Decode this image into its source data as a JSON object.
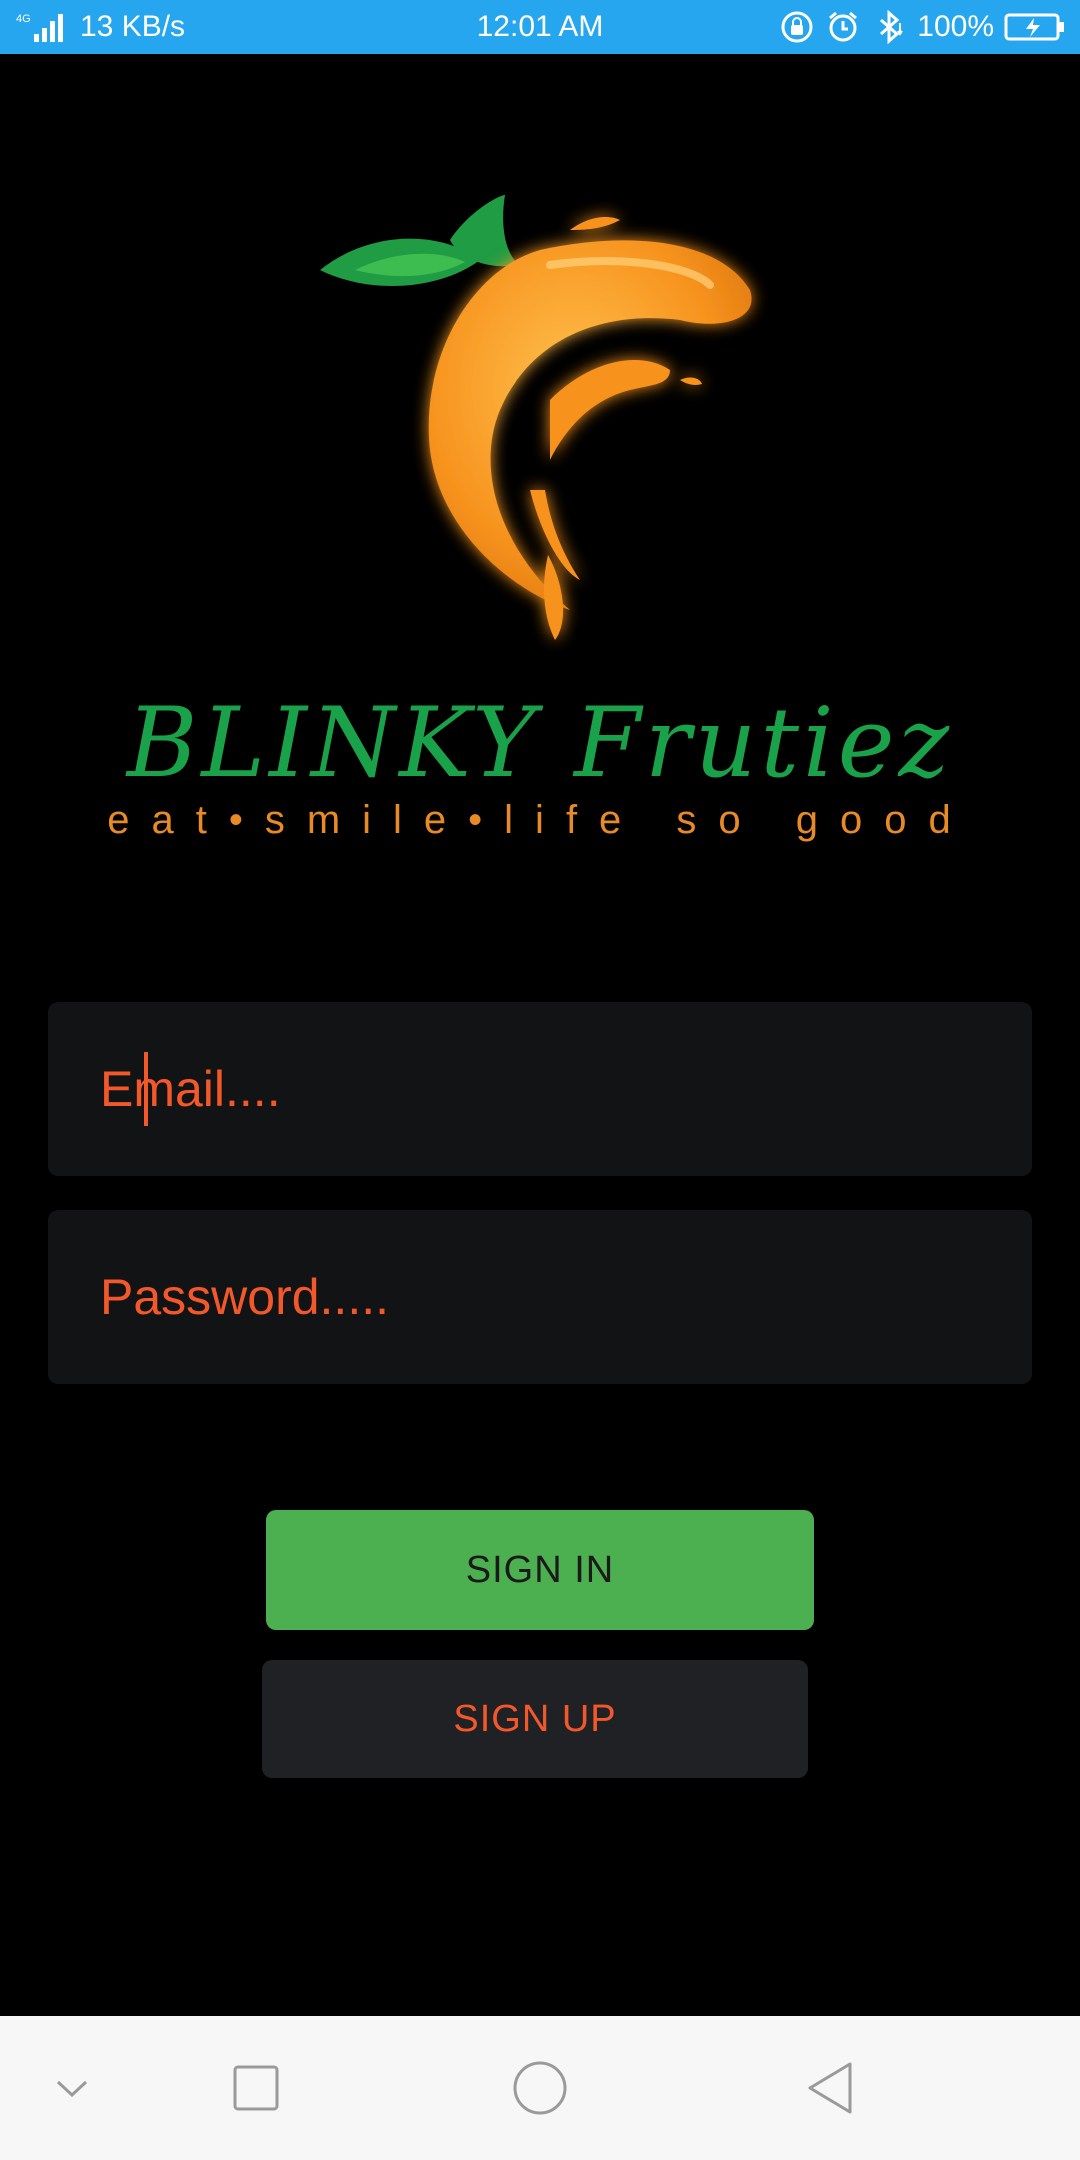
{
  "status_bar": {
    "network": "4G",
    "speed": "13 KB/s",
    "time": "12:01 AM",
    "battery": "100%",
    "icons": [
      "signal-icon",
      "rotation-lock-icon",
      "alarm-icon",
      "bluetooth-icon",
      "battery-charging-icon"
    ]
  },
  "logo": {
    "brand": "BLINKY Frutiez",
    "tagline": "eat•smile•life so good"
  },
  "form": {
    "email_placeholder": "Email....",
    "password_placeholder": "Password....."
  },
  "buttons": {
    "sign_in": "SIGN IN",
    "sign_up": "SIGN UP"
  },
  "nav_bar": {
    "icons": [
      "chevron-down-icon",
      "recents-icon",
      "home-icon",
      "back-icon"
    ]
  },
  "colors": {
    "status_bar": "#26a6ef",
    "background": "#000000",
    "accent_orange": "#f2582a",
    "brand_green": "#1aa24a",
    "sign_in_green": "#4caf50"
  }
}
